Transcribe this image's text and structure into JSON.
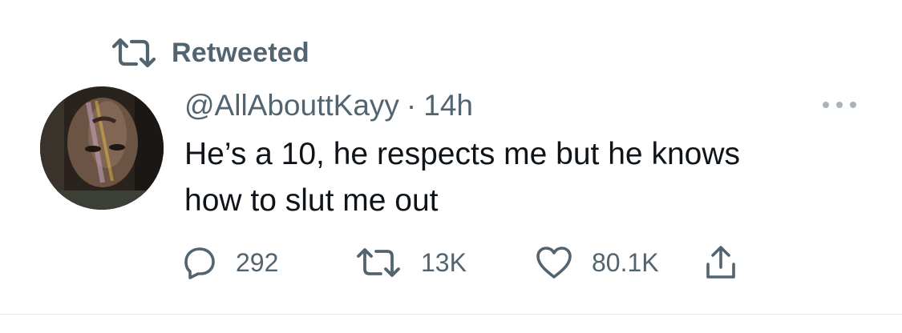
{
  "retweet_header": {
    "label": "Retweeted",
    "icon": "retweet-icon"
  },
  "tweet": {
    "handle": "@AllAbouttKayy",
    "separator": "·",
    "time": "14h",
    "text_line1": "He’s a 10, he respects me but he knows",
    "text_line2": "how to slut me out",
    "more_icon": "more-icon"
  },
  "actions": {
    "reply": {
      "icon": "reply-icon",
      "count": "292"
    },
    "retweet": {
      "icon": "retweet-icon",
      "count": "13K"
    },
    "like": {
      "icon": "heart-icon",
      "count": "80.1K"
    },
    "share": {
      "icon": "share-icon"
    }
  },
  "colors": {
    "secondary_text": "#536471",
    "primary_text": "#0f1419",
    "divider": "#e6e8ea"
  }
}
